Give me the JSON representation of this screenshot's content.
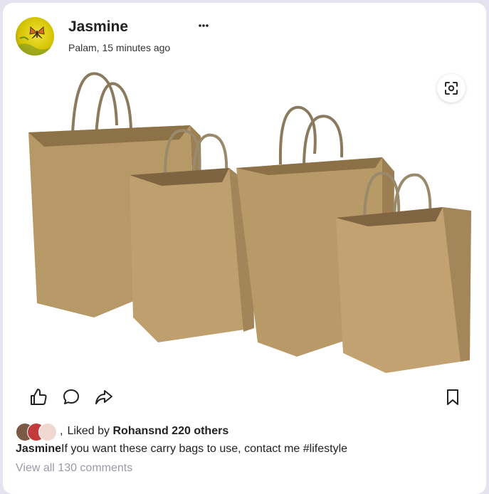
{
  "post": {
    "author": "Jasmine",
    "location": "Palam",
    "time": "15 minutes ago",
    "meta_line": "Palam, 15 minutes ago",
    "image_subject": "kraft paper shopping bags"
  },
  "likes": {
    "prefix": "Liked by",
    "first_liker": "Rohansnd",
    "others": "220 others",
    "separator": ","
  },
  "caption": {
    "author": "Jasmine",
    "text": "If you want these carry bags to use, contact me #lifestyle"
  },
  "comments": {
    "view_all": "View all 130 comments"
  },
  "icons": {
    "more": "more-horizontal-icon",
    "scan": "scan-icon",
    "like": "thumbs-up-icon",
    "comment": "comment-bubble-icon",
    "share": "share-arrow-icon",
    "save": "bookmark-icon"
  },
  "colors": {
    "background": "#e6e3f0",
    "card": "#ffffff",
    "text": "#222222",
    "muted": "#9a9aa8",
    "avatar_yellow": "#d9c700"
  }
}
